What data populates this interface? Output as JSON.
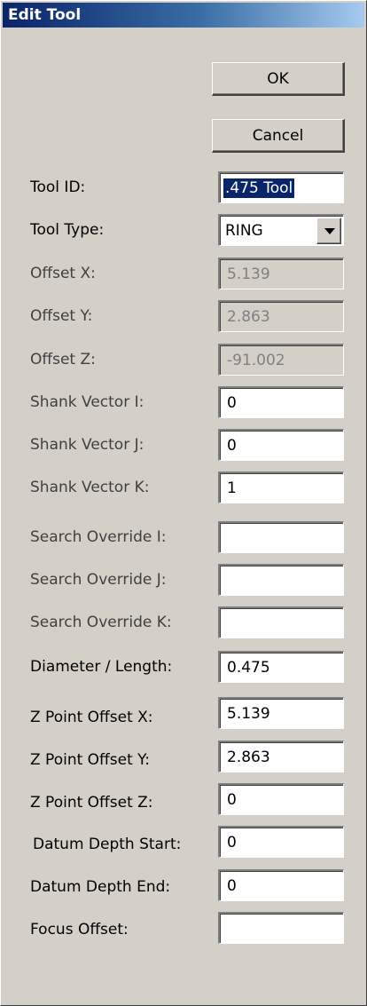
{
  "window": {
    "title": "Edit Tool"
  },
  "buttons": {
    "ok": "OK",
    "cancel": "Cancel"
  },
  "fields": {
    "tool_id": {
      "label": "Tool ID:",
      "value": ".475 Tool"
    },
    "tool_type": {
      "label": "Tool Type:",
      "value": "RING",
      "options": [
        "RING"
      ]
    },
    "offset_x": {
      "label": "Offset X:",
      "value": "5.139"
    },
    "offset_y": {
      "label": "Offset Y:",
      "value": "2.863"
    },
    "offset_z": {
      "label": "Offset Z:",
      "value": "-91.002"
    },
    "shank_vector_i": {
      "label": "Shank Vector I:",
      "value": "0"
    },
    "shank_vector_j": {
      "label": "Shank Vector J:",
      "value": "0"
    },
    "shank_vector_k": {
      "label": "Shank Vector K:",
      "value": "1"
    },
    "search_override_i": {
      "label": "Search Override I:",
      "value": ""
    },
    "search_override_j": {
      "label": "Search Override J:",
      "value": ""
    },
    "search_override_k": {
      "label": "Search Override K:",
      "value": ""
    },
    "diameter_length": {
      "label": "Diameter / Length:",
      "value": "0.475"
    },
    "z_point_offset_x": {
      "label": "Z Point Offset X:",
      "value": "5.139"
    },
    "z_point_offset_y": {
      "label": "Z Point Offset Y:",
      "value": "2.863"
    },
    "z_point_offset_z": {
      "label": "Z Point Offset Z:",
      "value": "0"
    },
    "datum_depth_start": {
      "label": "Datum Depth Start:",
      "value": "0"
    },
    "datum_depth_end": {
      "label": "Datum Depth End:",
      "value": "0"
    },
    "focus_offset": {
      "label": "Focus Offset:",
      "value": ""
    }
  }
}
